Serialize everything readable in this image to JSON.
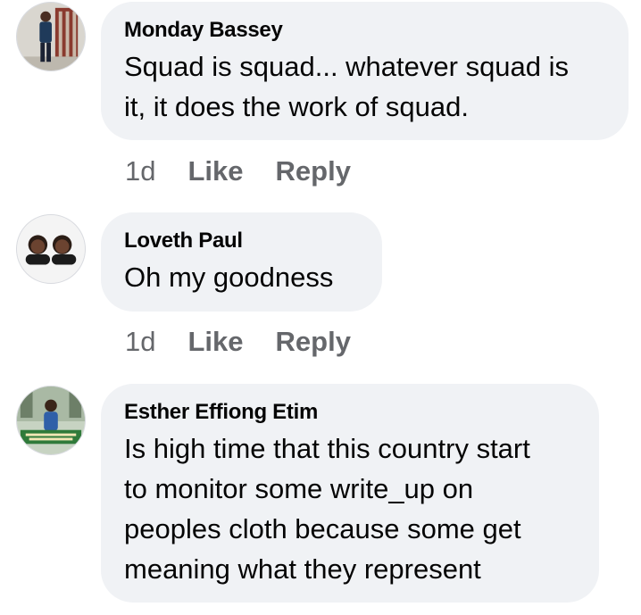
{
  "comments": [
    {
      "author": "Monday Bassey",
      "text": "Squad is squad... whatever squad is\nit, it does the work of squad.",
      "time": "1d",
      "like_label": "Like",
      "reply_label": "Reply"
    },
    {
      "author": "Loveth Paul",
      "text": "Oh my goodness",
      "time": "1d",
      "like_label": "Like",
      "reply_label": "Reply"
    },
    {
      "author": "Esther Effiong Etim",
      "text": "Is high time that this country start\nto monitor some write_up on\npeoples cloth because some get\nmeaning what they represent",
      "time": "",
      "like_label": "",
      "reply_label": ""
    }
  ],
  "colors": {
    "bubble_bg": "#f0f2f5",
    "meta_text": "#65676b",
    "primary_text": "#050505"
  }
}
